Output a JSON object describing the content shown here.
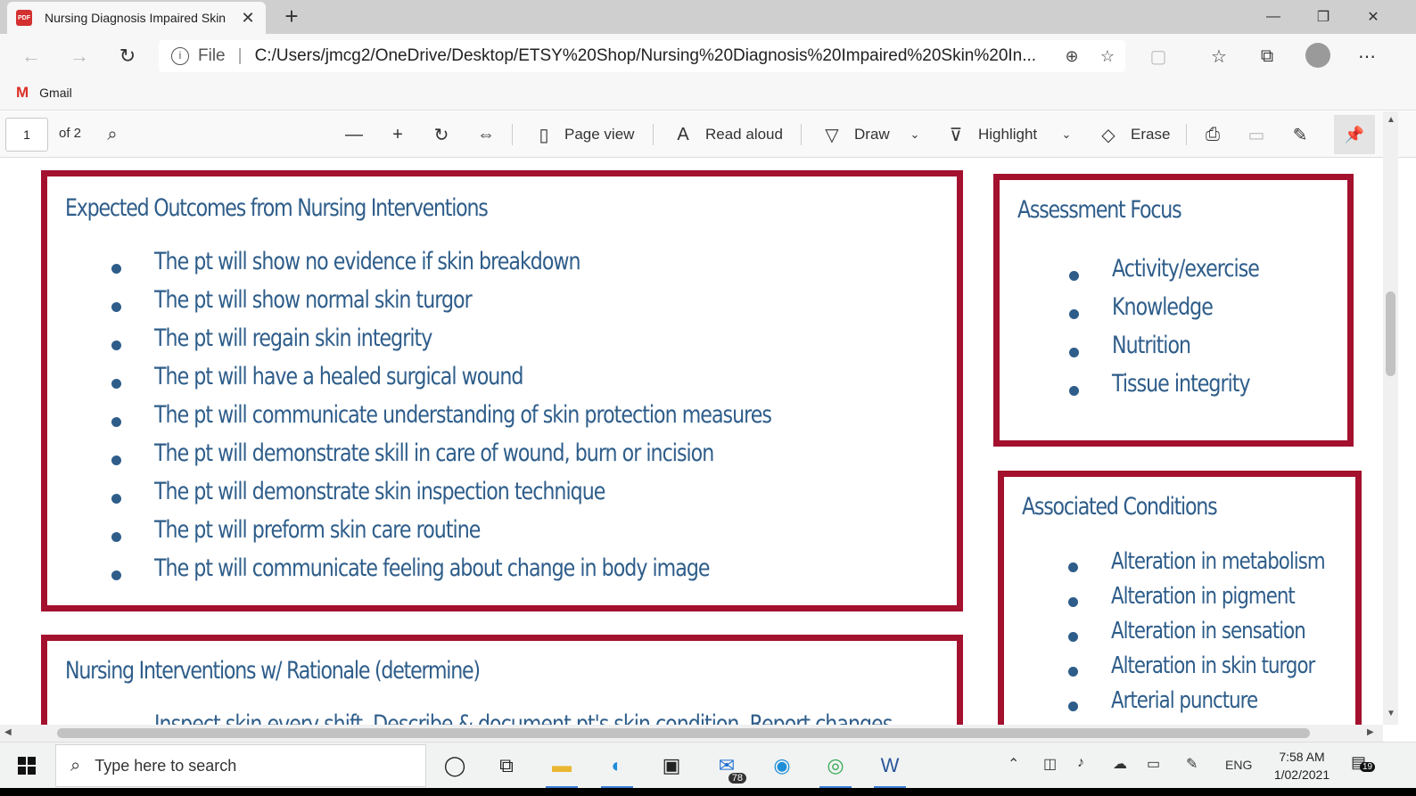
{
  "browser": {
    "tab_title": "Nursing Diagnosis Impaired Skin",
    "tab_icon": "PDF",
    "new_tab": "+",
    "address_label": "File",
    "url": "C:/Users/jmcg2/OneDrive/Desktop/ETSY%20Shop/Nursing%20Diagnosis%20Impaired%20Skin%20In...",
    "favorites": [
      {
        "label": "Gmail"
      }
    ]
  },
  "pdf_toolbar": {
    "page_number": "1",
    "page_total": "of 2",
    "page_view": "Page view",
    "read_aloud": "Read aloud",
    "draw": "Draw",
    "highlight": "Highlight",
    "erase": "Erase"
  },
  "document": {
    "expected_outcomes": {
      "heading": "Expected Outcomes from Nursing Interventions",
      "items": [
        "The pt will show no evidence if skin breakdown",
        "The pt will show normal skin turgor",
        "The pt will regain skin integrity",
        "The pt will have a healed surgical wound",
        "The pt will communicate understanding of skin protection measures",
        "The pt will demonstrate skill in care of wound, burn or incision",
        "The pt will demonstrate skin inspection technique",
        "The pt will preform skin care routine",
        "The pt will communicate feeling about change in body image"
      ]
    },
    "assessment_focus": {
      "heading": "Assessment Focus",
      "items": [
        "Activity/exercise",
        "Knowledge",
        "Nutrition",
        "Tissue integrity"
      ]
    },
    "associated_conditions": {
      "heading": "Associated Conditions",
      "items": [
        "Alteration in metabolism",
        "Alteration in pigment",
        "Alteration in sensation",
        "Alteration in skin turgor",
        "Arterial puncture"
      ]
    },
    "nursing_interventions": {
      "heading": "Nursing Interventions w/ Rationale (determine)",
      "items": [
        "Inspect skin every shift. Describe & document pt's skin condition. Report changes"
      ]
    },
    "colors": {
      "border": "#a3112e",
      "text": "#2e5d8a"
    }
  },
  "taskbar": {
    "search_placeholder": "Type here to search",
    "mail_badge": "78",
    "language": "ENG",
    "time": "7:58 AM",
    "date": "1/02/2021",
    "notification_count": "19"
  }
}
